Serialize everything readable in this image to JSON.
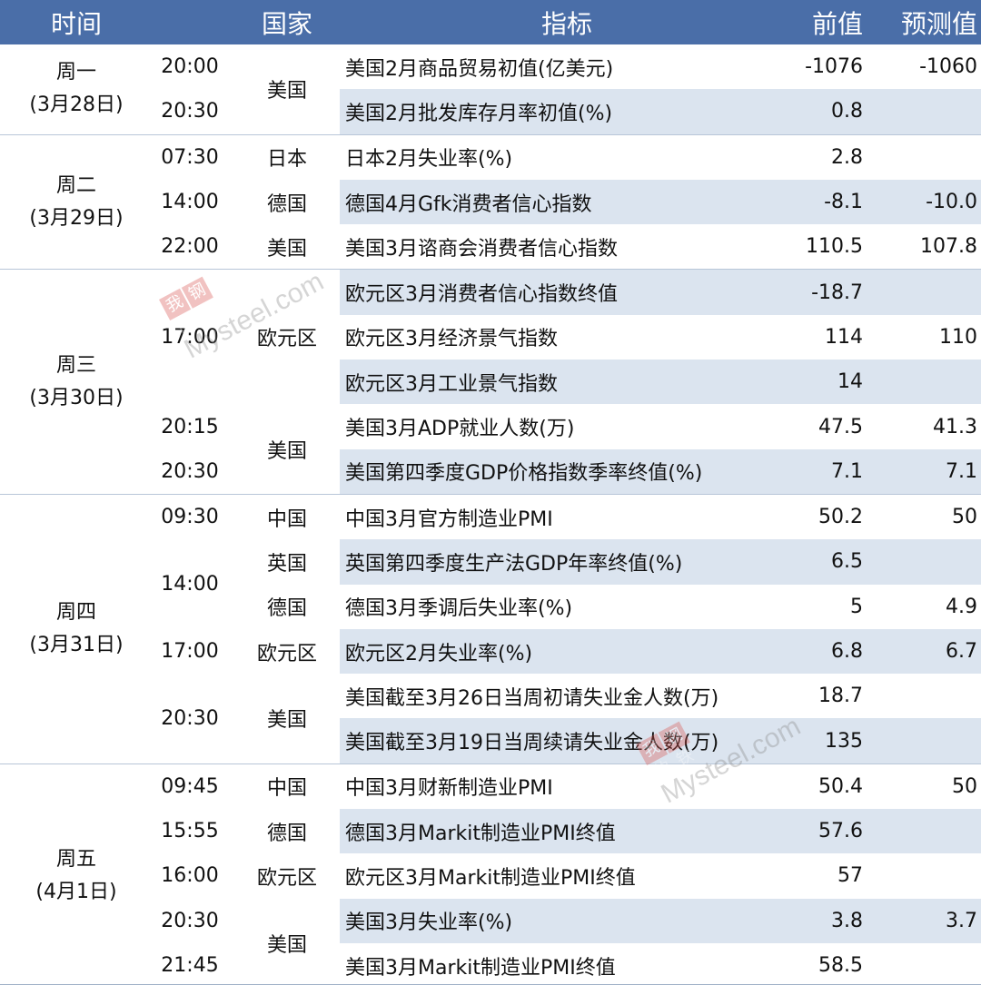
{
  "header": {
    "time": "时间",
    "country": "国家",
    "indicator": "指标",
    "prev": "前值",
    "forecast": "预测值"
  },
  "days": [
    {
      "day": "周一",
      "date": "(3月28日)"
    },
    {
      "day": "周二",
      "date": "(3月29日)"
    },
    {
      "day": "周三",
      "date": "(3月30日)"
    },
    {
      "day": "周四",
      "date": "(3月31日)"
    },
    {
      "day": "周五",
      "date": "(4月1日)"
    }
  ],
  "rows": [
    {
      "time": "20:00",
      "country": "美国",
      "indicator": "美国2月商品贸易初值(亿美元)",
      "prev": "-1076",
      "forecast": "-1060"
    },
    {
      "time": "20:30",
      "country": "",
      "indicator": "美国2月批发库存月率初值(%)",
      "prev": "0.8",
      "forecast": ""
    },
    {
      "time": "07:30",
      "country": "日本",
      "indicator": "日本2月失业率(%)",
      "prev": "2.8",
      "forecast": ""
    },
    {
      "time": "14:00",
      "country": "德国",
      "indicator": "德国4月Gfk消费者信心指数",
      "prev": "-8.1",
      "forecast": "-10.0"
    },
    {
      "time": "22:00",
      "country": "美国",
      "indicator": "美国3月谘商会消费者信心指数",
      "prev": "110.5",
      "forecast": "107.8"
    },
    {
      "time": "",
      "country": "",
      "indicator": "欧元区3月消费者信心指数终值",
      "prev": "-18.7",
      "forecast": ""
    },
    {
      "time": "17:00",
      "country": "欧元区",
      "indicator": "欧元区3月经济景气指数",
      "prev": "114",
      "forecast": "110"
    },
    {
      "time": "",
      "country": "",
      "indicator": "欧元区3月工业景气指数",
      "prev": "14",
      "forecast": ""
    },
    {
      "time": "20:15",
      "country": "美国",
      "indicator": "美国3月ADP就业人数(万)",
      "prev": "47.5",
      "forecast": "41.3"
    },
    {
      "time": "20:30",
      "country": "",
      "indicator": "美国第四季度GDP价格指数季率终值(%)",
      "prev": "7.1",
      "forecast": "7.1"
    },
    {
      "time": "09:30",
      "country": "中国",
      "indicator": "中国3月官方制造业PMI",
      "prev": "50.2",
      "forecast": "50"
    },
    {
      "time": "14:00",
      "country": "英国",
      "indicator": "英国第四季度生产法GDP年率终值(%)",
      "prev": "6.5",
      "forecast": ""
    },
    {
      "time": "",
      "country": "德国",
      "indicator": "德国3月季调后失业率(%)",
      "prev": "5",
      "forecast": "4.9"
    },
    {
      "time": "17:00",
      "country": "欧元区",
      "indicator": "欧元区2月失业率(%)",
      "prev": "6.8",
      "forecast": "6.7"
    },
    {
      "time": "20:30",
      "country": "美国",
      "indicator": "美国截至3月26日当周初请失业金人数(万)",
      "prev": "18.7",
      "forecast": ""
    },
    {
      "time": "",
      "country": "",
      "indicator": "美国截至3月19日当周续请失业金人数(万)",
      "prev": "135",
      "forecast": ""
    },
    {
      "time": "09:45",
      "country": "中国",
      "indicator": "中国3月财新制造业PMI",
      "prev": "50.4",
      "forecast": "50"
    },
    {
      "time": "15:55",
      "country": "德国",
      "indicator": "德国3月Markit制造业PMI终值",
      "prev": "57.6",
      "forecast": ""
    },
    {
      "time": "16:00",
      "country": "欧元区",
      "indicator": "欧元区3月Markit制造业PMI终值",
      "prev": "57",
      "forecast": ""
    },
    {
      "time": "20:30",
      "country": "美国",
      "indicator": "美国3月失业率(%)",
      "prev": "3.8",
      "forecast": "3.7"
    },
    {
      "time": "21:45",
      "country": "",
      "indicator": "美国3月Markit制造业PMI终值",
      "prev": "58.5",
      "forecast": ""
    }
  ],
  "watermark": {
    "cn1": "我的",
    "cn2": "钢铁",
    "brand": "Mysteel",
    "domain": ".com"
  },
  "colors": {
    "header_bg": "#4a6ea8",
    "row_shade": "#dbe4ef"
  }
}
